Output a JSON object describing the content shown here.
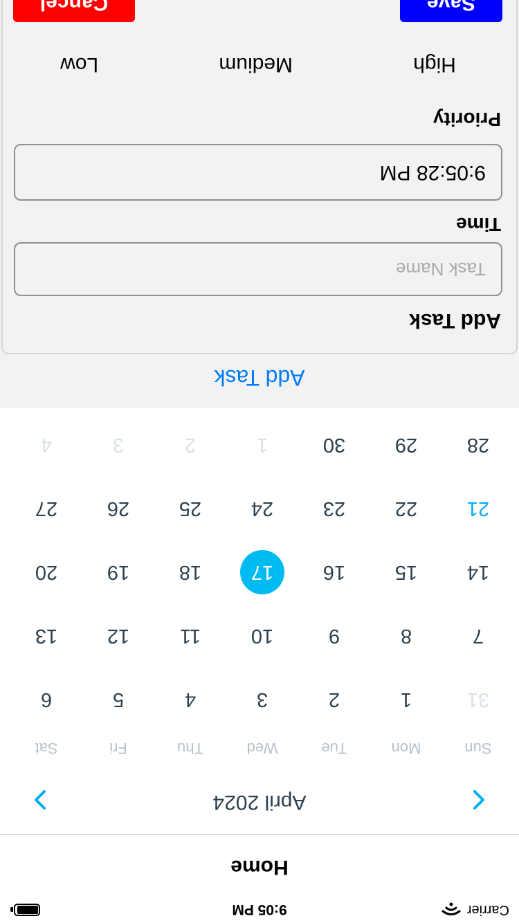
{
  "status_bar": {
    "carrier": "Carrier",
    "time": "9:05 PM"
  },
  "nav": {
    "title": "Home"
  },
  "calendar": {
    "month_label": "April 2024",
    "weekdays": [
      "Sun",
      "Mon",
      "Tue",
      "Wed",
      "Thu",
      "Fri",
      "Sat"
    ],
    "days": [
      {
        "d": "31",
        "state": "other"
      },
      {
        "d": "1"
      },
      {
        "d": "2"
      },
      {
        "d": "3"
      },
      {
        "d": "4"
      },
      {
        "d": "5"
      },
      {
        "d": "6"
      },
      {
        "d": "7"
      },
      {
        "d": "8"
      },
      {
        "d": "9"
      },
      {
        "d": "10"
      },
      {
        "d": "11"
      },
      {
        "d": "12"
      },
      {
        "d": "13"
      },
      {
        "d": "14"
      },
      {
        "d": "15"
      },
      {
        "d": "16"
      },
      {
        "d": "17",
        "state": "selected"
      },
      {
        "d": "18"
      },
      {
        "d": "19"
      },
      {
        "d": "20"
      },
      {
        "d": "21",
        "state": "today"
      },
      {
        "d": "22"
      },
      {
        "d": "23"
      },
      {
        "d": "24"
      },
      {
        "d": "25"
      },
      {
        "d": "26"
      },
      {
        "d": "27"
      },
      {
        "d": "28"
      },
      {
        "d": "29"
      },
      {
        "d": "30"
      },
      {
        "d": "1",
        "state": "other"
      },
      {
        "d": "2",
        "state": "other"
      },
      {
        "d": "3",
        "state": "other"
      },
      {
        "d": "4",
        "state": "other"
      }
    ],
    "selected_color": "#00bbf2",
    "today_color": "#00adf5"
  },
  "add_task_link": "Add Task",
  "form": {
    "title": "Add Task",
    "task_name_placeholder": "Task Name",
    "time_label": "Time",
    "time_value": "9:05:28 PM",
    "priority_label": "Priority",
    "priorities": [
      "High",
      "Medium",
      "Low"
    ],
    "save_label": "Save",
    "cancel_label": "Cancel"
  },
  "colors": {
    "link": "#007aff",
    "save": "#0000ff",
    "cancel": "#ff0000"
  }
}
